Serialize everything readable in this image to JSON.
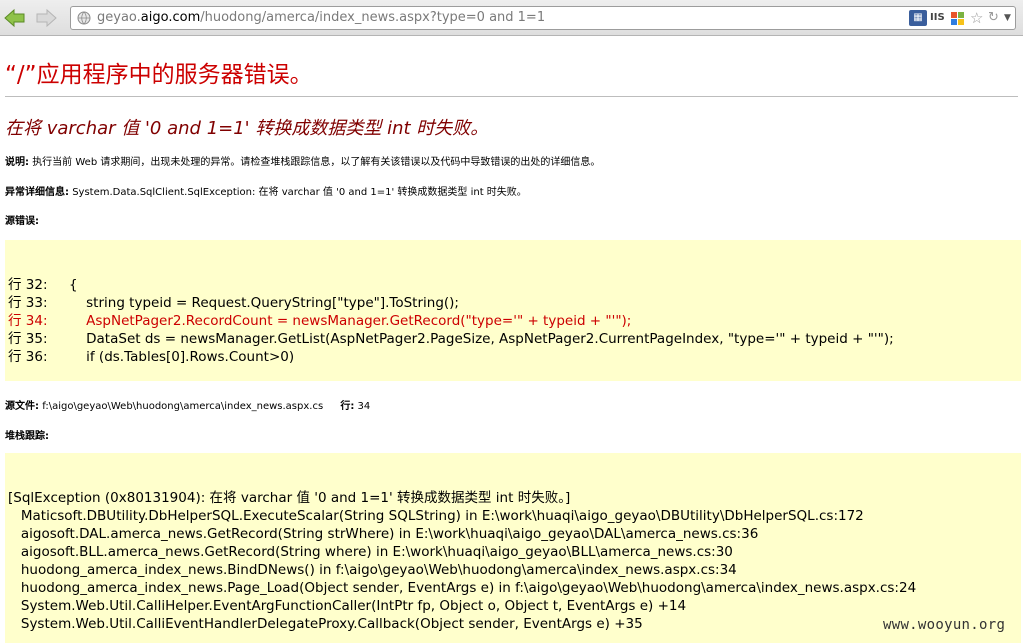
{
  "browser": {
    "url_scheme_part": "geyao.",
    "url_host": "aigo.com",
    "url_path": "/huodong/amerca/index_news.aspx?type=0 and 1=1",
    "addon_2_label": "IIS"
  },
  "page": {
    "title": "“/”应用程序中的服务器错误。",
    "subtitle": "在将 varchar 值 '0 and 1=1' 转换成数据类型 int 时失败。",
    "description_label": "说明:",
    "description_text": "执行当前 Web 请求期间，出现未处理的异常。请检查堆栈跟踪信息，以了解有关该错误以及代码中导致错误的出处的详细信息。",
    "exception_label": "异常详细信息:",
    "exception_text": "System.Data.SqlClient.SqlException: 在将 varchar 值 '0 and 1=1' 转换成数据类型 int 时失败。",
    "source_error_label": "源错误:",
    "source_lines": [
      "行 32:     {",
      "行 33:         string typeid = Request.QueryString[\"type\"].ToString();",
      "行 34:         AspNetPager2.RecordCount = newsManager.GetRecord(\"type='\" + typeid + \"'\");",
      "行 35:         DataSet ds = newsManager.GetList(AspNetPager2.PageSize, AspNetPager2.CurrentPageIndex, \"type='\" + typeid + \"'\");",
      "行 36:         if (ds.Tables[0].Rows.Count>0)"
    ],
    "source_file_label": "源文件:",
    "source_file_path": "f:\\aigo\\geyao\\Web\\huodong\\amerca\\index_news.aspx.cs",
    "line_label": "行:",
    "line_number": "34",
    "stack_label": "堆栈跟踪:",
    "stack_lines": [
      "[SqlException (0x80131904): 在将 varchar 值 '0 and 1=1' 转换成数据类型 int 时失败。]",
      "   Maticsoft.DBUtility.DbHelperSQL.ExecuteScalar(String SQLString) in E:\\work\\huaqi\\aigo_geyao\\DBUtility\\DbHelperSQL.cs:172",
      "   aigosoft.DAL.amerca_news.GetRecord(String strWhere) in E:\\work\\huaqi\\aigo_geyao\\DAL\\amerca_news.cs:36",
      "   aigosoft.BLL.amerca_news.GetRecord(String where) in E:\\work\\huaqi\\aigo_geyao\\BLL\\amerca_news.cs:30",
      "   huodong_amerca_index_news.BindDNews() in f:\\aigo\\geyao\\Web\\huodong\\amerca\\index_news.aspx.cs:34",
      "   huodong_amerca_index_news.Page_Load(Object sender, EventArgs e) in f:\\aigo\\geyao\\Web\\huodong\\amerca\\index_news.aspx.cs:24",
      "   System.Web.Util.CalliHelper.EventArgFunctionCaller(IntPtr fp, Object o, Object t, EventArgs e) +14",
      "   System.Web.Util.CalliEventHandlerDelegateProxy.Callback(Object sender, EventArgs e) +35"
    ],
    "watermark": "www.wooyun.org"
  },
  "colors": {
    "title_red": "#cc0000",
    "subtitle_maroon": "#800000",
    "code_background": "#ffffcc"
  }
}
